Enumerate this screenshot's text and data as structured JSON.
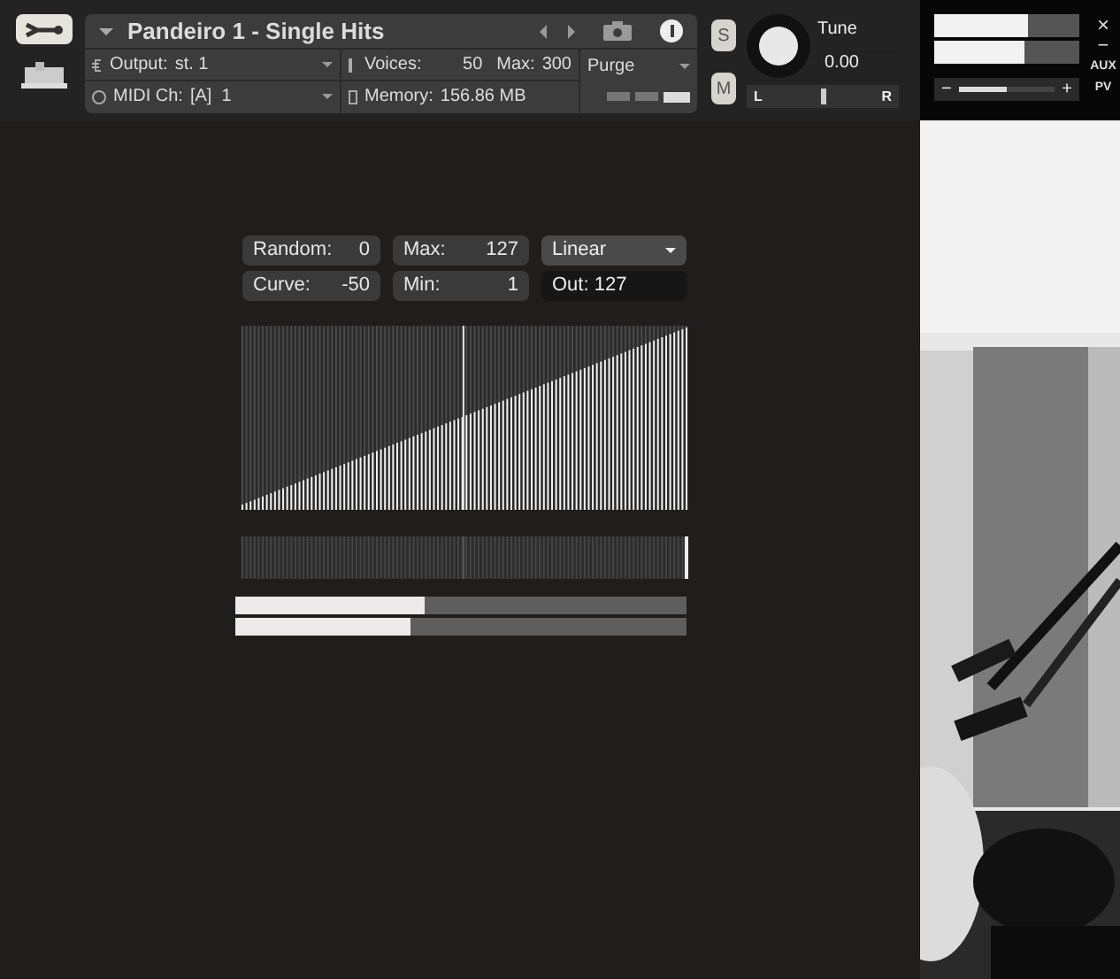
{
  "instrument": {
    "name": "Pandeiro 1 - Single Hits",
    "output_label": "Output:",
    "output": "st. 1",
    "midi_label": "MIDI Ch:",
    "midi": "[A]  1",
    "voices_label": "Voices:",
    "voices": "50",
    "max_label": "Max:",
    "max": "300",
    "memory_label": "Memory:",
    "memory": "156.86 MB",
    "purge": "Purge",
    "solo": "S",
    "mute": "M",
    "tune_label": "Tune",
    "tune": "0.00",
    "pan_left": "L",
    "pan_right": "R",
    "pan": {
      "level": 0.5
    }
  },
  "output_meters": [
    {
      "level": 0.65
    },
    {
      "level": 0.62
    }
  ],
  "volume": {
    "level": 0.5,
    "minus": "−",
    "plus": "+"
  },
  "window_buttons": {
    "close": "×",
    "minimize": "−",
    "aux": "AUX",
    "pv": "PV"
  },
  "controls": [
    {
      "label": "Random:",
      "value": "0"
    },
    {
      "label": "Max:",
      "value": "127"
    },
    {
      "label": "Curve:",
      "value": "-50"
    },
    {
      "label": "Min:",
      "value": "1"
    }
  ],
  "mode": "Linear",
  "out": "Out: 127",
  "bars": [
    {
      "level": 0.42
    },
    {
      "level": 0.39
    }
  ]
}
